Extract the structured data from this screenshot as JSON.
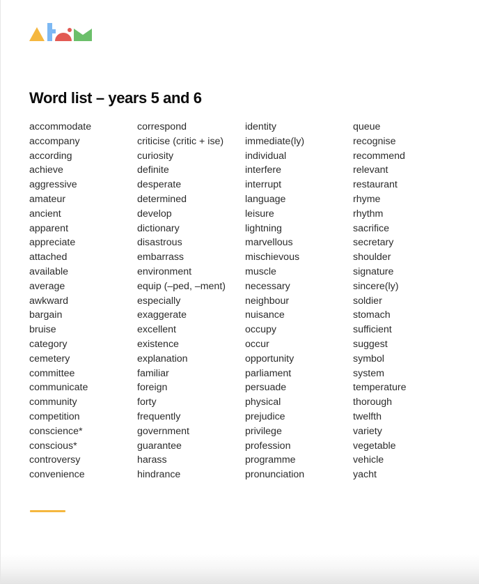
{
  "logo": {
    "name": "atom-logo",
    "colors": {
      "triangle": "#F5B73F",
      "bar": "#7DB8F3",
      "dome": "#E25A53",
      "dot": "#E25A53",
      "zigzag": "#6BBF6A"
    }
  },
  "title": "Word list – years 5 and 6",
  "accent_color": "#F5B73F",
  "text_color": "#2b2b2b",
  "columns": [
    {
      "words": [
        "accommodate",
        "accompany",
        "according",
        "achieve",
        "aggressive",
        "amateur",
        "ancient",
        "apparent",
        "appreciate",
        "attached",
        "available",
        "average",
        "awkward",
        "bargain",
        "bruise",
        "category",
        "cemetery",
        "committee",
        "communicate",
        "community",
        "competition",
        "conscience*",
        "conscious*",
        "controversy",
        "convenience"
      ]
    },
    {
      "words": [
        "correspond",
        "criticise (critic + ise)",
        "curiosity",
        "definite",
        "desperate",
        "determined",
        "develop",
        "dictionary",
        "disastrous",
        "embarrass",
        "environment",
        "equip (–ped, –ment)",
        "especially",
        "exaggerate",
        "excellent",
        "existence",
        "explanation",
        "familiar",
        "foreign",
        "forty",
        "frequently",
        "government",
        "guarantee",
        "harass",
        "hindrance"
      ]
    },
    {
      "words": [
        "identity",
        "immediate(ly)",
        "individual",
        "interfere",
        "interrupt",
        "language",
        "leisure",
        "lightning",
        "marvellous",
        "mischievous",
        "muscle",
        "necessary",
        "neighbour",
        "nuisance",
        "occupy",
        "occur",
        "opportunity",
        "parliament",
        "persuade",
        "physical",
        "prejudice",
        "privilege",
        "profession",
        "programme",
        "pronunciation"
      ]
    },
    {
      "words": [
        "queue",
        "recognise",
        "recommend",
        "relevant",
        "restaurant",
        "rhyme",
        "rhythm",
        "sacrifice",
        "secretary",
        "shoulder",
        "signature",
        "sincere(ly)",
        "soldier",
        "stomach",
        "sufficient",
        "suggest",
        "symbol",
        "system",
        "temperature",
        "thorough",
        "twelfth",
        "variety",
        "vegetable",
        "vehicle",
        "yacht"
      ]
    }
  ]
}
